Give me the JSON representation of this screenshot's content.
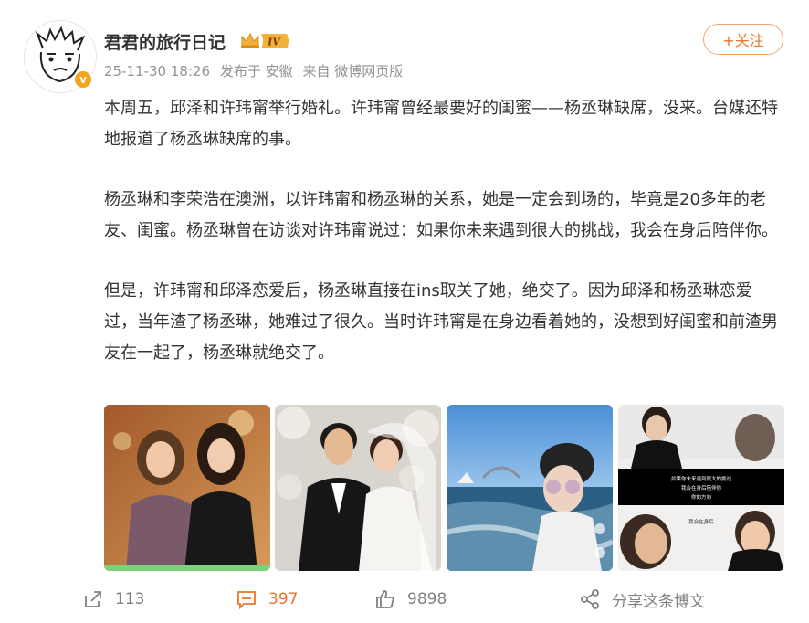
{
  "post": {
    "author": "君君的旅行日记",
    "level_badge": "IV",
    "verified_badge": "v",
    "meta": {
      "timestamp": "25-11-30 18:26",
      "location": "发布于 安徽",
      "source": "来自 微博网页版"
    },
    "follow_label": "+关注",
    "paragraphs": [
      "本周五，邱泽和许玮甯举行婚礼。许玮甯曾经最要好的闺蜜——杨丞琳缺席，没来。台媒还特地报道了杨丞琳缺席的事。",
      "杨丞琳和李荣浩在澳洲，以许玮甯和杨丞琳的关系，她是一定会到场的，毕竟是20多年的老友、闺蜜。杨丞琳曾在访谈对许玮甯说过：如果你未来遇到很大的挑战，我会在身后陪伴你。",
      "但是，许玮甯和邱泽恋爱后，杨丞琳直接在ins取关了她，绝交了。因为邱泽和杨丞琳恋爱过，当年渣了杨丞琳，她难过了很久。当时许玮甯是在身边看着她的，没想到好闺蜜和前渣男友在一起了，杨丞琳就绝交了。"
    ],
    "images": [
      {
        "name": "photo-two-women-event"
      },
      {
        "name": "photo-wedding-couple"
      },
      {
        "name": "photo-harbour-selfie"
      },
      {
        "name": "photo-interview-collage",
        "captions": [
          "如果你未来遇到很大的挑战",
          "我会在身后陪伴你",
          "你的方向",
          "我会在身后"
        ]
      }
    ],
    "actions": {
      "share_count": "113",
      "comment_count": "397",
      "like_count": "9898",
      "share_post_label": "分享这条博文"
    }
  },
  "colors": {
    "accent_orange": "#e8762b",
    "meta_gray": "#939393",
    "text": "#333333"
  },
  "icons": {
    "repost": "repost-icon",
    "comment": "comment-icon",
    "like": "like-icon",
    "share": "share-icon"
  }
}
